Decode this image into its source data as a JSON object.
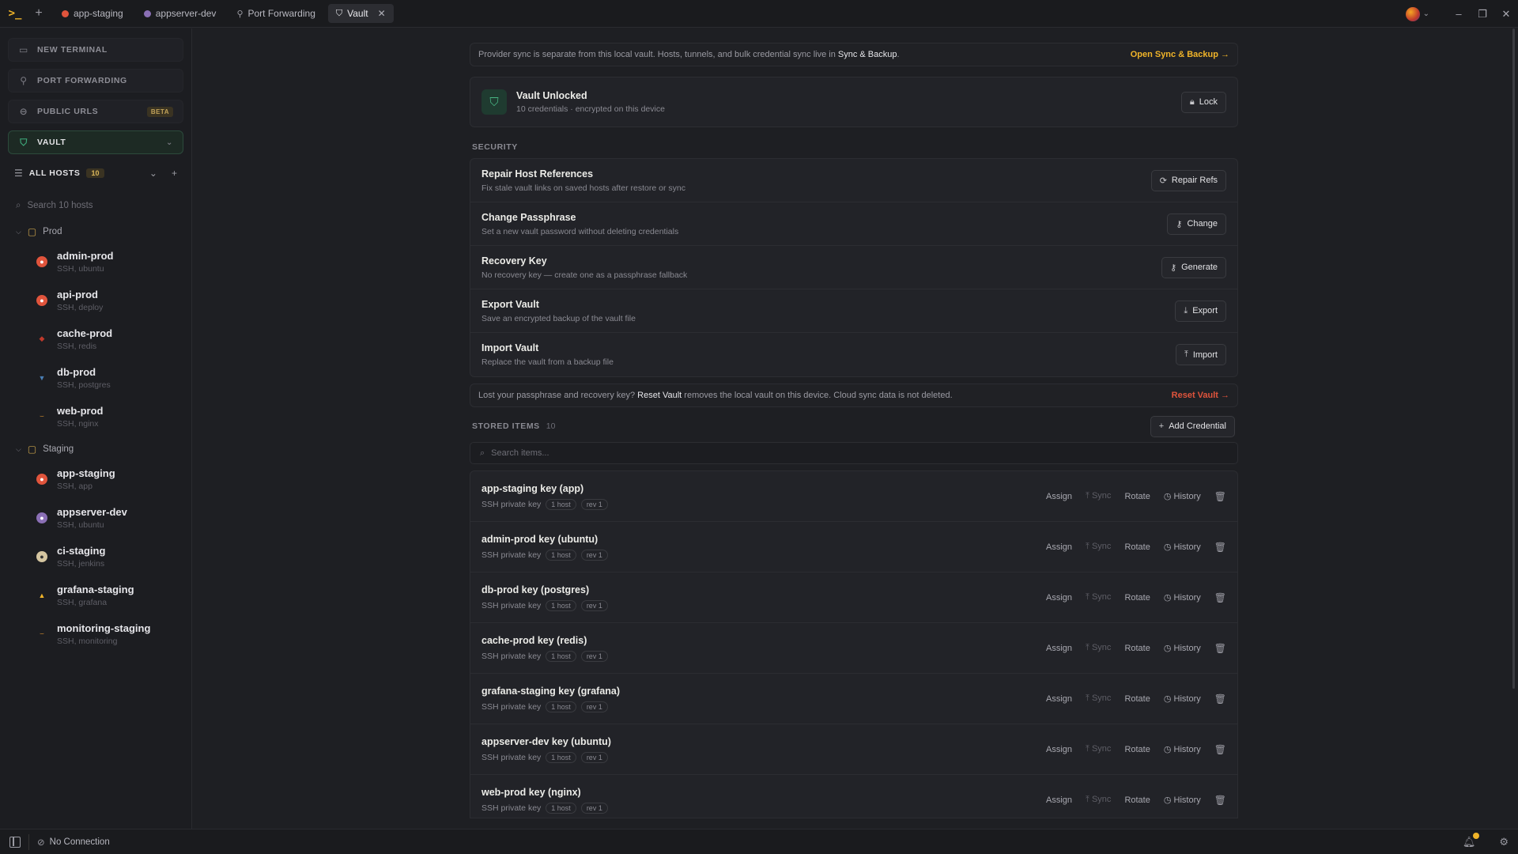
{
  "titlebar": {
    "tabs": [
      {
        "label": "app-staging",
        "icon": "ubuntu-icon",
        "color": "#e0543c"
      },
      {
        "label": "appserver-dev",
        "icon": "ubuntu-icon",
        "color": "#8a6fb5"
      },
      {
        "label": "Port Forwarding",
        "icon": "port-forward-icon",
        "color": "#9a9aa2"
      },
      {
        "label": "Vault",
        "icon": "shield-icon",
        "color": "#d4d4d8"
      }
    ]
  },
  "sidebar": {
    "nav": [
      {
        "label": "NEW TERMINAL",
        "icon": "terminal-icon"
      },
      {
        "label": "PORT FORWARDING",
        "icon": "port-forward-icon"
      },
      {
        "label": "PUBLIC URLS",
        "icon": "link-icon",
        "badge": "BETA"
      },
      {
        "label": "VAULT",
        "icon": "shield-icon"
      }
    ],
    "hosts_title": "ALL HOSTS",
    "hosts_count": "10",
    "search_placeholder": "Search 10 hosts",
    "folders": [
      {
        "name": "Prod",
        "hosts": [
          {
            "name": "admin-prod",
            "sub": "SSH, ubuntu",
            "color": "#e0543c"
          },
          {
            "name": "api-prod",
            "sub": "SSH, deploy",
            "color": "#e0543c"
          },
          {
            "name": "cache-prod",
            "sub": "SSH, redis",
            "color": "#c0392b"
          },
          {
            "name": "db-prod",
            "sub": "SSH, postgres",
            "color": "#336791"
          },
          {
            "name": "web-prod",
            "sub": "SSH, nginx",
            "color": "#f0a030"
          }
        ]
      },
      {
        "name": "Staging",
        "hosts": [
          {
            "name": "app-staging",
            "sub": "SSH, app",
            "color": "#e0543c"
          },
          {
            "name": "appserver-dev",
            "sub": "SSH, ubuntu",
            "color": "#8a6fb5"
          },
          {
            "name": "ci-staging",
            "sub": "SSH, jenkins",
            "color": "#d4c5a0"
          },
          {
            "name": "grafana-staging",
            "sub": "SSH, grafana",
            "color": "#f0b429"
          },
          {
            "name": "monitoring-staging",
            "sub": "SSH, monitoring",
            "color": "#f0a030"
          }
        ]
      }
    ]
  },
  "banner": {
    "text_before": "Provider sync is separate from this local vault. Hosts, tunnels, and bulk credential sync live in ",
    "emph": "Sync & Backup",
    "text_after": ".",
    "link": "Open Sync & Backup →"
  },
  "vault_status": {
    "title": "Vault Unlocked",
    "subtitle": "10 credentials · encrypted on this device",
    "lock_label": "Lock"
  },
  "security": {
    "label": "SECURITY",
    "rows": [
      {
        "title": "Repair Host References",
        "desc": "Fix stale vault links on saved hosts after restore or sync",
        "button": "Repair Refs",
        "icon": "refresh-icon"
      },
      {
        "title": "Change Passphrase",
        "desc": "Set a new vault password without deleting credentials",
        "button": "Change",
        "icon": "key-icon"
      },
      {
        "title": "Recovery Key",
        "desc": "No recovery key — create one as a passphrase fallback",
        "button": "Generate",
        "icon": "key-icon"
      },
      {
        "title": "Export Vault",
        "desc": "Save an encrypted backup of the vault file",
        "button": "Export",
        "icon": "download-icon"
      },
      {
        "title": "Import Vault",
        "desc": "Replace the vault from a backup file",
        "button": "Import",
        "icon": "upload-icon"
      }
    ]
  },
  "warning": {
    "text_before": "Lost your passphrase and recovery key? ",
    "emph": "Reset Vault",
    "text_after": " removes the local vault on this device. Cloud sync data is not deleted.",
    "link": "Reset Vault →"
  },
  "stored": {
    "label": "STORED ITEMS",
    "count": "10",
    "add_label": "Add Credential",
    "search_placeholder": "Search items...",
    "action_labels": {
      "assign": "Assign",
      "sync": "Sync",
      "rotate": "Rotate",
      "history": "History"
    },
    "items": [
      {
        "title": "app-staging key (app)",
        "type": "SSH private key",
        "hosts": "1 host",
        "rev": "rev 1"
      },
      {
        "title": "admin-prod key (ubuntu)",
        "type": "SSH private key",
        "hosts": "1 host",
        "rev": "rev 1"
      },
      {
        "title": "db-prod key (postgres)",
        "type": "SSH private key",
        "hosts": "1 host",
        "rev": "rev 1"
      },
      {
        "title": "cache-prod key (redis)",
        "type": "SSH private key",
        "hosts": "1 host",
        "rev": "rev 1"
      },
      {
        "title": "grafana-staging key (grafana)",
        "type": "SSH private key",
        "hosts": "1 host",
        "rev": "rev 1"
      },
      {
        "title": "appserver-dev key (ubuntu)",
        "type": "SSH private key",
        "hosts": "1 host",
        "rev": "rev 1"
      },
      {
        "title": "web-prod key (nginx)",
        "type": "SSH private key",
        "hosts": "1 host",
        "rev": "rev 1"
      }
    ]
  },
  "statusbar": {
    "connection": "No Connection"
  },
  "colors": {
    "accent": "#f0b429",
    "vault_green": "#48b684",
    "danger": "#e0543c"
  }
}
